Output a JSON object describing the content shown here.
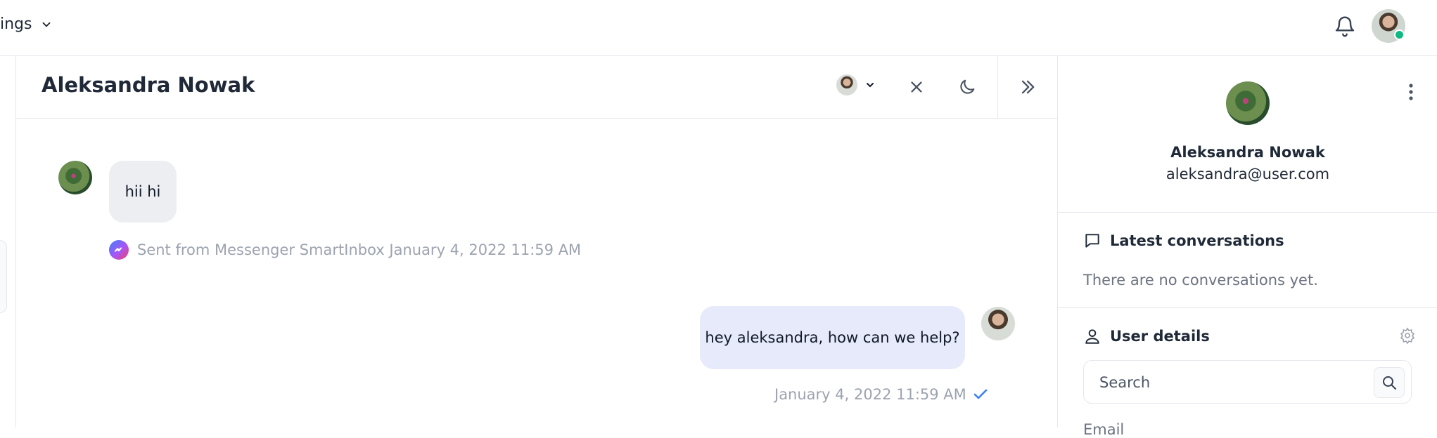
{
  "topbar": {
    "nav_label": "ings"
  },
  "chat": {
    "title": "Aleksandra Nowak",
    "messages": [
      {
        "direction": "incoming",
        "text": "hii hi",
        "meta": "Sent from Messenger SmartInbox January 4, 2022 11:59 AM"
      },
      {
        "direction": "outgoing",
        "text": "hey aleksandra, how can we help?",
        "meta": "January 4, 2022 11:59 AM"
      }
    ]
  },
  "sidebar": {
    "name": "Aleksandra Nowak",
    "email": "aleksandra@user.com",
    "latest_title": "Latest conversations",
    "no_conversations": "There are no conversations yet.",
    "details_title": "User details",
    "search_placeholder": "Search",
    "cut_text": "Email"
  },
  "colors": {
    "accent": "#3b82f6",
    "online": "#10b981",
    "bubble_in": "#eceef2",
    "bubble_out": "#e6eafb"
  },
  "icons": [
    "chevron-down-icon",
    "bell-icon",
    "close-icon",
    "moon-icon",
    "double-chevron-right-icon",
    "messenger-icon",
    "check-icon",
    "kebab-icon",
    "chat-bubble-icon",
    "user-icon",
    "gear-icon",
    "search-icon"
  ]
}
